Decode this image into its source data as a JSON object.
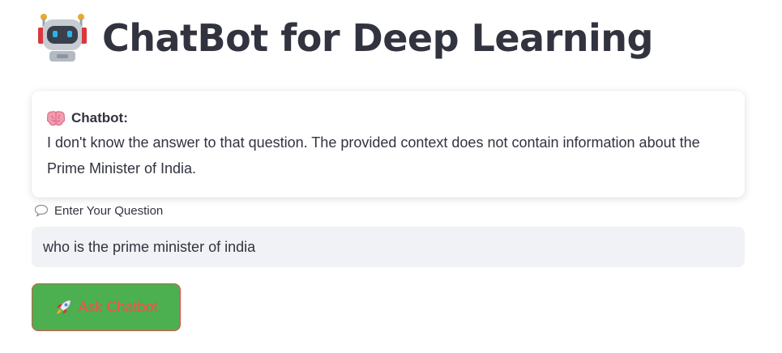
{
  "header": {
    "title": "ChatBot for Deep Learning",
    "icon": "robot-icon"
  },
  "response_card": {
    "icon": "brain-icon",
    "label": "Chatbot:",
    "text": "I don't know the answer to that question. The provided context does not contain information about the Prime Minister of India."
  },
  "question_field": {
    "icon": "speech-bubble-icon",
    "label": "Enter Your Question",
    "value": "who is the prime minister of india"
  },
  "ask_button": {
    "icon": "rocket-icon",
    "label": "Ask Chatbot",
    "background_color": "#4caf50",
    "text_color": "#ff4b4b",
    "border_color": "#d9534f"
  },
  "colors": {
    "text": "#31333f",
    "input_background": "#f0f2f6"
  }
}
